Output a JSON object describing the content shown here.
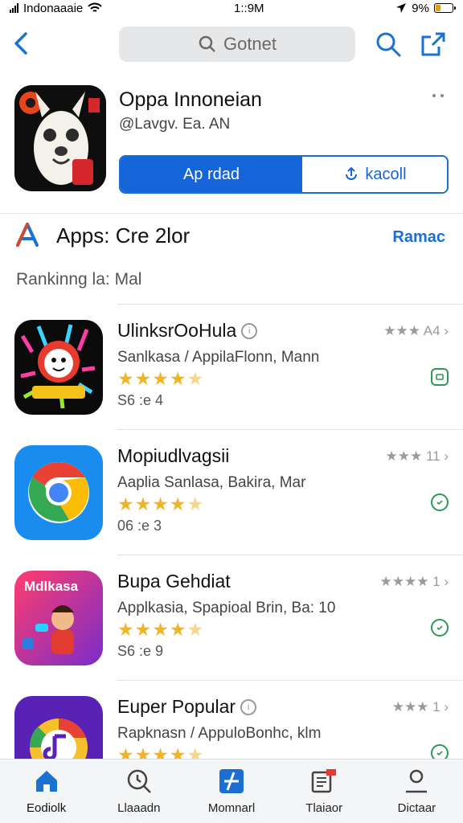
{
  "status": {
    "carrier": "Indonaaaie",
    "time": "1::9M",
    "battery": "9%"
  },
  "nav": {
    "search_text": "Gotnet"
  },
  "featured": {
    "title": "Oppa Innoneian",
    "subtitle": "@Lavgv. Ea. AN",
    "primary_button": "Ap rdad",
    "secondary_button": "kacoll"
  },
  "section": {
    "title": "Apps: Cre 2lor",
    "link": "Ramac",
    "ranking_label": "Rankinng la: Mal"
  },
  "apps": [
    {
      "name": "UlinksrOoHula",
      "meta": "Sanlkasa / AppilaFlonn, Mann",
      "size": "S6 :e   4",
      "rank": "★★★ A4",
      "stars_full": 4,
      "stars_half": 1,
      "icon": "ghost-character-icon"
    },
    {
      "name": "Mopiudlvagsii",
      "meta": "Aaplia Sanlasa, Bakira, Mar",
      "size": "06 :e   3",
      "rank": "★★★ 11",
      "stars_full": 4,
      "stars_half": 1,
      "icon": "chrome-icon"
    },
    {
      "name": "Bupa Gehdiat",
      "meta": "Applkasia, Spapioal Brin, Ba: 10",
      "size": "S6 :e   9",
      "rank": "★★★★ 1",
      "stars_full": 4,
      "stars_half": 1,
      "icon": "character-game-icon",
      "icon_text": "Mdlkasa"
    },
    {
      "name": "Euper Popular",
      "meta": "Rapknasn / AppuloBonhc, klm",
      "size": "",
      "rank": "★★★ 1",
      "stars_full": 4,
      "stars_half": 1,
      "icon": "music-app-icon"
    }
  ],
  "tabs": [
    {
      "label": "Eodiolk",
      "icon": "home-icon"
    },
    {
      "label": "Llaaadn",
      "icon": "search-clock-icon"
    },
    {
      "label": "Momnarl",
      "icon": "apps-icon"
    },
    {
      "label": "Tlaiaor",
      "icon": "news-icon"
    },
    {
      "label": "Dictaar",
      "icon": "profile-icon"
    }
  ],
  "colors": {
    "accent": "#1a73d1",
    "primary_button": "#1565d8",
    "star": "#f0b429",
    "get_green": "#2a9a54"
  }
}
